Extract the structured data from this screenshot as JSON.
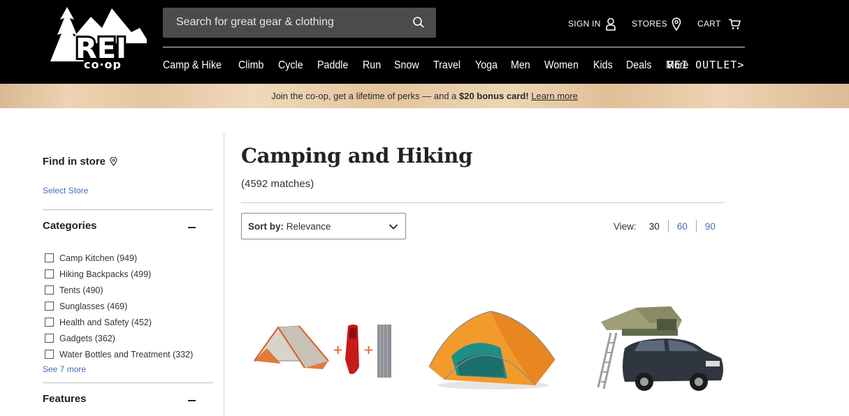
{
  "header": {
    "search_placeholder": "Search for great gear & clothing",
    "sign_in": "SIGN IN",
    "stores": "STORES",
    "cart": "CART",
    "nav": [
      "Camp & Hike",
      "Climb",
      "Cycle",
      "Paddle",
      "Run",
      "Snow",
      "Travel",
      "Yoga",
      "Men",
      "Women",
      "Kids",
      "Deals",
      "More"
    ],
    "outlet": "REI OUTLET",
    "outlet_arrow": ">"
  },
  "promo": {
    "text_before": "Join the co-op, get a lifetime of perks — and a ",
    "bold": "$20 bonus card!",
    "link": "Learn more"
  },
  "sidebar": {
    "find_in_store": "Find in store",
    "select_store": "Select Store",
    "categories_title": "Categories",
    "categories": [
      "Camp Kitchen (949)",
      "Hiking Backpacks (499)",
      "Tents (490)",
      "Sunglasses (469)",
      "Health and Safety (452)",
      "Gadgets (362)",
      "Water Bottles and Treatment (332)"
    ],
    "see_more": "See 7 more",
    "features_title": "Features"
  },
  "main": {
    "title": "Camping and Hiking",
    "matches": "(4592 matches)",
    "sort_label": "Sort by:",
    "sort_value": "Relevance",
    "view_label": "View:",
    "view_options": [
      "30",
      "60",
      "90"
    ]
  },
  "colors": {
    "header_bg": "#000000",
    "link": "#406eb5",
    "promo_bg": "#e8cca8"
  },
  "icons": [
    "search-icon",
    "user-icon",
    "location-pin-icon",
    "cart-icon",
    "chevron-down-icon",
    "minus-icon"
  ]
}
